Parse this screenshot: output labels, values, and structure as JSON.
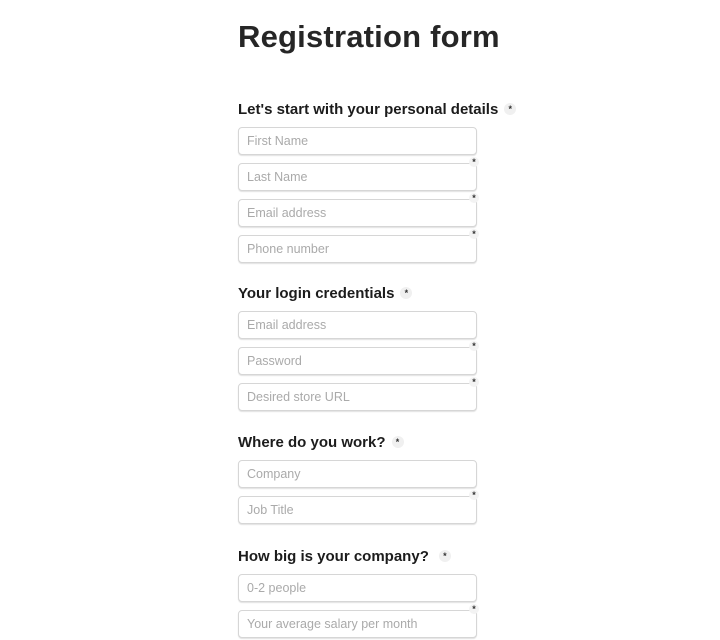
{
  "title": "Registration form",
  "required_marker": "*",
  "sections": [
    {
      "heading": "Let's start with your personal details",
      "fields": [
        {
          "placeholder": "First Name",
          "value": ""
        },
        {
          "placeholder": "Last Name",
          "value": ""
        },
        {
          "placeholder": "Email address",
          "value": ""
        },
        {
          "placeholder": "Phone number",
          "value": ""
        }
      ]
    },
    {
      "heading": "Your login credentials",
      "fields": [
        {
          "placeholder": "Email address",
          "value": ""
        },
        {
          "placeholder": "Password",
          "value": ""
        },
        {
          "placeholder": "Desired store URL",
          "value": ""
        }
      ]
    },
    {
      "heading": "Where do you work?",
      "fields": [
        {
          "placeholder": "Company",
          "value": ""
        },
        {
          "placeholder": "Job Title",
          "value": ""
        }
      ]
    },
    {
      "heading": "How big is your company?",
      "fields": [
        {
          "placeholder": "0-2 people",
          "value": ""
        },
        {
          "placeholder": "Your average salary per month",
          "value": ""
        }
      ]
    }
  ]
}
